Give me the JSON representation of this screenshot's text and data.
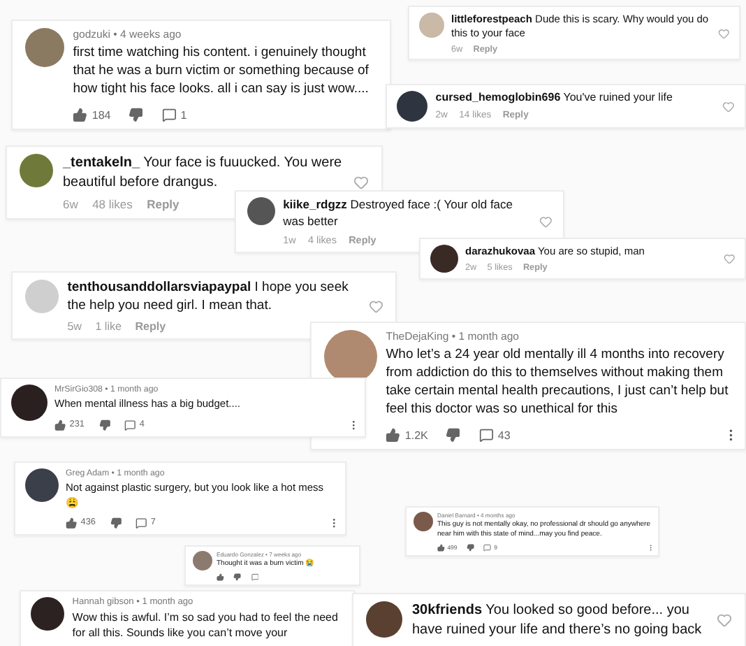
{
  "comments": [
    {
      "kind": "youtube",
      "byline": "godzuki • 4 weeks ago",
      "text": "first time watching his content. i genuinely thought that he was a burn victim or something because of how tight his face looks. all i can say is just wow....",
      "actions": true,
      "likes": "184",
      "replies": "1",
      "menu": false
    },
    {
      "kind": "instagram",
      "text": "**littleforestpeach** Dude this is scary. Why would you do this to your face",
      "time": "6w",
      "reply": "Reply"
    },
    {
      "kind": "instagram",
      "text": "**cursed_hemoglobin696** You've ruined your life",
      "time": "2w",
      "likes": "14 likes",
      "reply": "Reply"
    },
    {
      "kind": "instagram",
      "text": "**_tentakeln_** Your face is fuuucked. You were beautiful before drangus.",
      "time": "6w",
      "likes": "48 likes",
      "reply": "Reply"
    },
    {
      "kind": "instagram",
      "text": "**kiike_rdgzz** Destroyed face :( Your old face was better",
      "time": "1w",
      "likes": "4 likes",
      "reply": "Reply"
    },
    {
      "kind": "instagram",
      "text": "**darazhukovaa** You are so stupid, man",
      "time": "2w",
      "likes": "5 likes",
      "reply": "Reply"
    },
    {
      "kind": "instagram",
      "text": "**tenthousanddollarsviapaypal** I hope you seek the help you need girl. I mean that.",
      "time": "5w",
      "likes": "1 like",
      "reply": "Reply"
    },
    {
      "kind": "youtube",
      "byline": "MrSirGio308 • 1 month ago",
      "text": "When mental illness has a big budget....",
      "actions": true,
      "likes": "231",
      "replies": "4",
      "menu": true
    },
    {
      "kind": "youtube",
      "byline": "TheDejaKing • 1 month ago",
      "text": "Who let’s a 24 year old mentally ill 4 months into recovery from addiction do this to themselves without making them take certain mental health precautions, I just can’t help but feel this doctor was so unethical for this",
      "actions": true,
      "likes": "1.2K",
      "replies": "43",
      "menu": true
    },
    {
      "kind": "youtube",
      "byline": "Greg Adam • 1 month ago",
      "text": "Not against plastic surgery, but you look like a hot mess 😩",
      "actions": true,
      "likes": "436",
      "replies": "7",
      "menu": true
    },
    {
      "kind": "youtube",
      "byline": "Eduardo Gonzalez • 7 weeks ago",
      "text": "Thought it was a burn victim 😭",
      "actions": true,
      "menu": false
    },
    {
      "kind": "youtube",
      "byline": "Hannah gibson • 1 month ago",
      "text": "Wow this is awful. I’m so sad you had to feel the need for all this. Sounds like you can’t move your"
    },
    {
      "kind": "youtube",
      "byline": "Daniel Barnard • 4 months ago",
      "text": "This guy is not mentally okay, no professional dr should go anywhere near him with this state of mind...may you find peace.",
      "actions": true,
      "likes": "499",
      "replies": "9",
      "menu": true
    },
    {
      "kind": "instagram",
      "text": "**30kfriends** You looked so good before... you have ruined your life and there’s no going back"
    }
  ]
}
